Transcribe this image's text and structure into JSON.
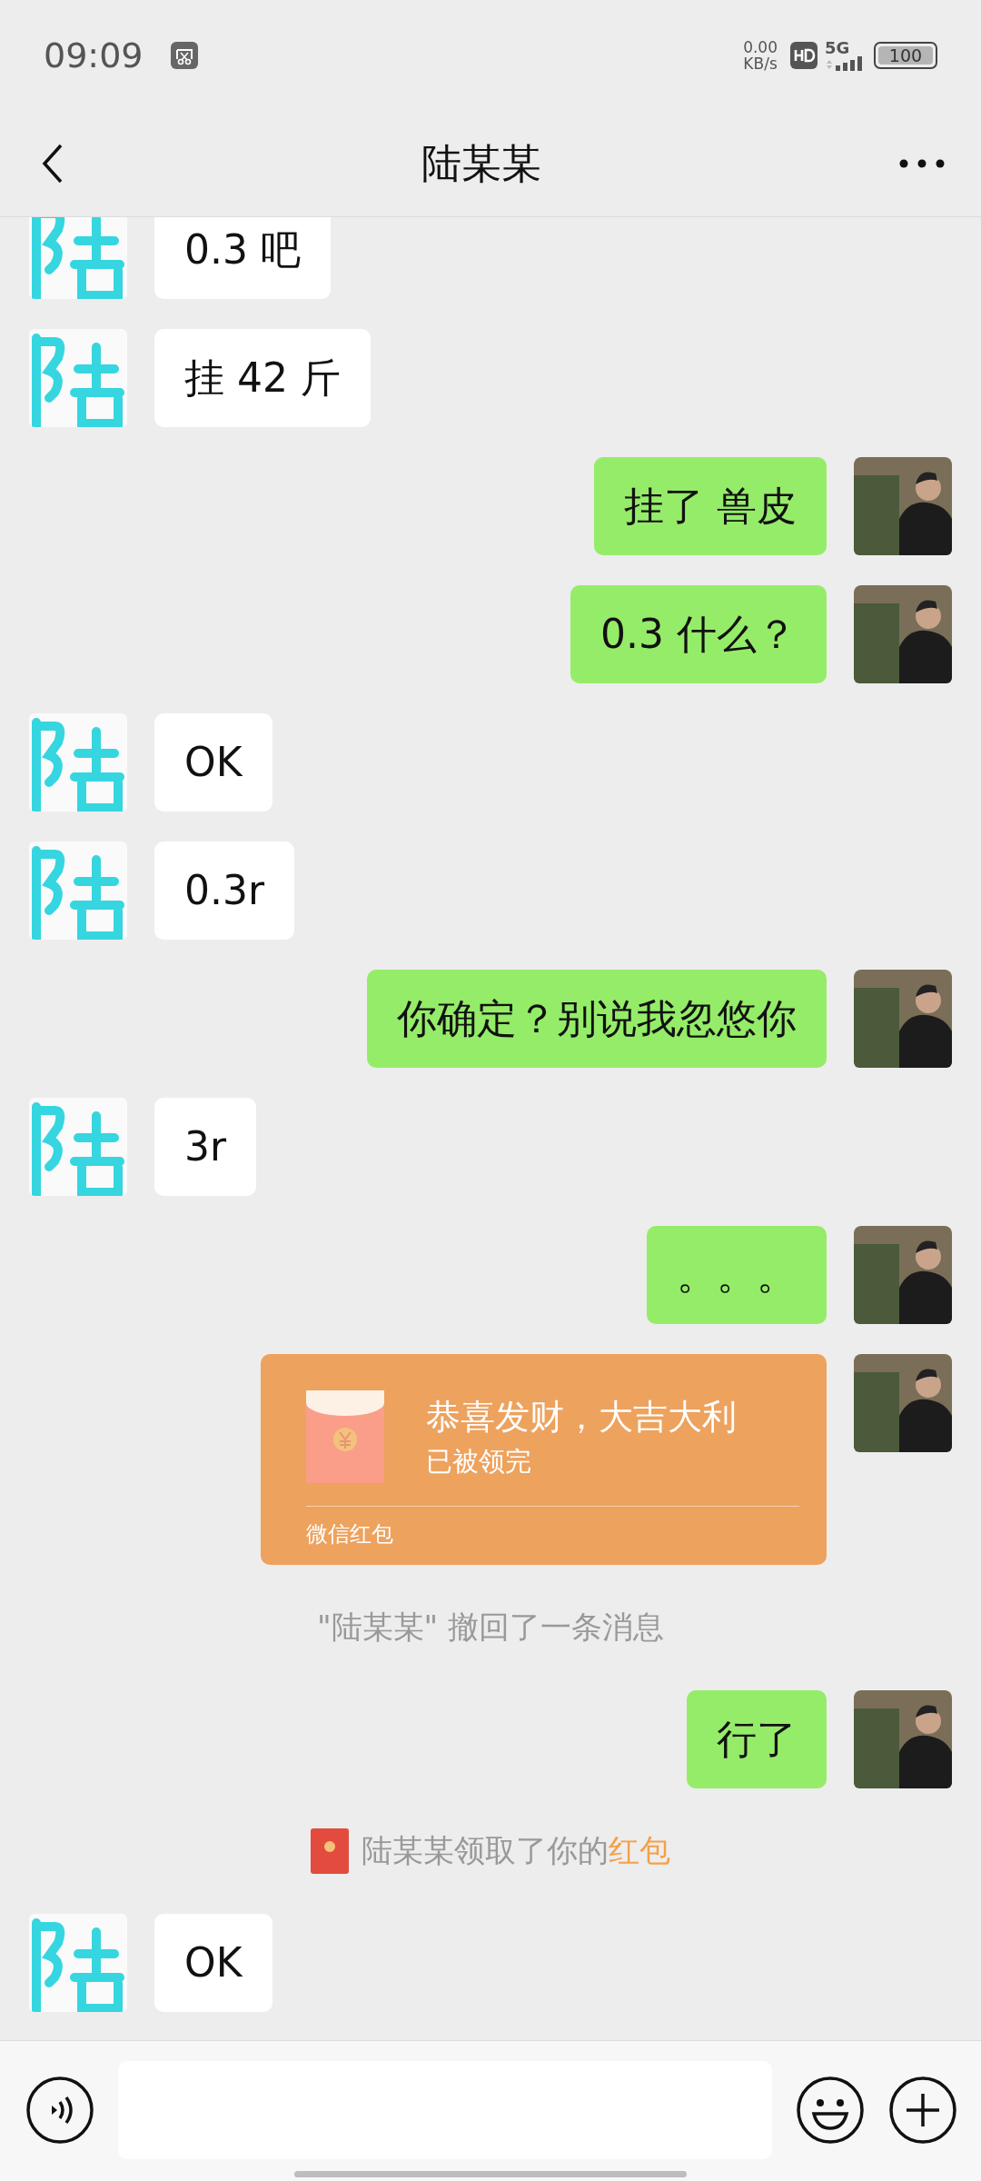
{
  "status_bar": {
    "time": "09:09",
    "net_speed": "0.00",
    "net_unit": "KB/s",
    "network": "5G",
    "battery": "100"
  },
  "header": {
    "title": "陆某某"
  },
  "messages": [
    {
      "kind": "text",
      "outgoing": false,
      "text": "0.3 吧"
    },
    {
      "kind": "text",
      "outgoing": false,
      "text": "挂 42 斤"
    },
    {
      "kind": "text",
      "outgoing": true,
      "text": "挂了 兽皮"
    },
    {
      "kind": "text",
      "outgoing": true,
      "text": "0.3 什么？"
    },
    {
      "kind": "text",
      "outgoing": false,
      "text": "OK"
    },
    {
      "kind": "text",
      "outgoing": false,
      "text": "0.3r"
    },
    {
      "kind": "text",
      "outgoing": true,
      "text": "你确定？别说我忽悠你"
    },
    {
      "kind": "text",
      "outgoing": false,
      "text": "3r"
    },
    {
      "kind": "text",
      "outgoing": true,
      "text": "。。。"
    },
    {
      "kind": "red_packet",
      "outgoing": true,
      "greeting": "恭喜发财，大吉大利",
      "status": "已被领完",
      "brand": "微信红包",
      "opened": true
    },
    {
      "kind": "recall",
      "text": "\"陆某某\" 撤回了一条消息"
    },
    {
      "kind": "text",
      "outgoing": true,
      "text": "行了"
    },
    {
      "kind": "packet_notice",
      "text": "陆某某领取了你的",
      "link": "红包"
    },
    {
      "kind": "text",
      "outgoing": false,
      "text": "OK"
    }
  ]
}
